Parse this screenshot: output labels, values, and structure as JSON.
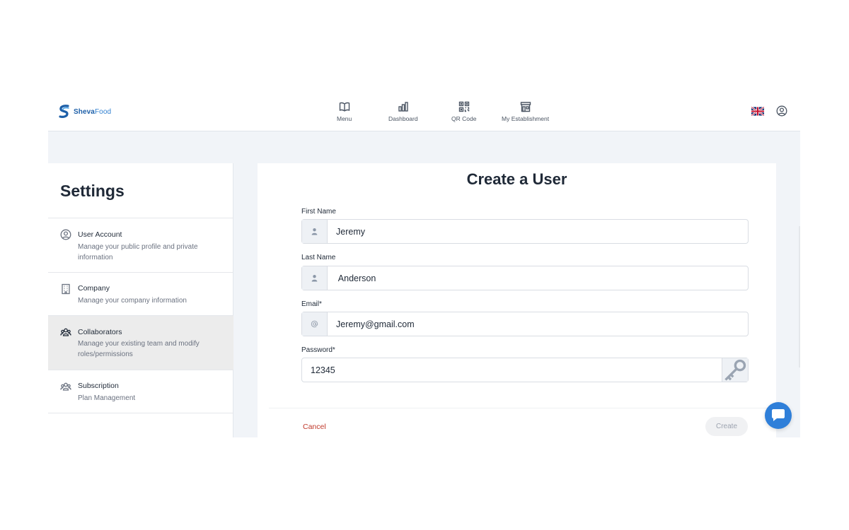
{
  "brand": {
    "name_bold": "Sheva",
    "name_light": "Food"
  },
  "nav": [
    {
      "label": "Menu",
      "icon": "book-icon"
    },
    {
      "label": "Dashboard",
      "icon": "bar-chart-icon"
    },
    {
      "label": "QR Code",
      "icon": "qr-code-icon"
    },
    {
      "label": "My Establishment",
      "icon": "store-icon"
    }
  ],
  "header": {
    "language_icon": "uk-flag-icon",
    "account_icon": "user-circle-icon"
  },
  "sidebar": {
    "title": "Settings",
    "items": [
      {
        "label": "User Account",
        "description": "Manage your public profile and private information",
        "icon": "user-circle-icon",
        "active": false
      },
      {
        "label": "Company",
        "description": "Manage your company information",
        "icon": "building-icon",
        "active": false
      },
      {
        "label": "Collaborators",
        "description": "Manage your existing team and modify roles/permissions",
        "icon": "team-icon",
        "active": true
      },
      {
        "label": "Subscription",
        "description": "Plan Management",
        "icon": "team-icon",
        "active": false
      }
    ]
  },
  "form": {
    "title": "Create a User",
    "fields": {
      "first_name": {
        "label": "First Name",
        "value": "Jeremy"
      },
      "last_name": {
        "label": "Last Name",
        "value": " Anderson"
      },
      "email": {
        "label": "Email*",
        "value": "Jeremy@gmail.com"
      },
      "password": {
        "label": "Password*",
        "value": "12345"
      }
    },
    "cancel_label": "Cancel",
    "create_label": "Create"
  },
  "colors": {
    "brand": "#1d5fa8",
    "cancel": "#c0392b",
    "chat": "#2f7fd9",
    "background": "#f1f4f8"
  }
}
